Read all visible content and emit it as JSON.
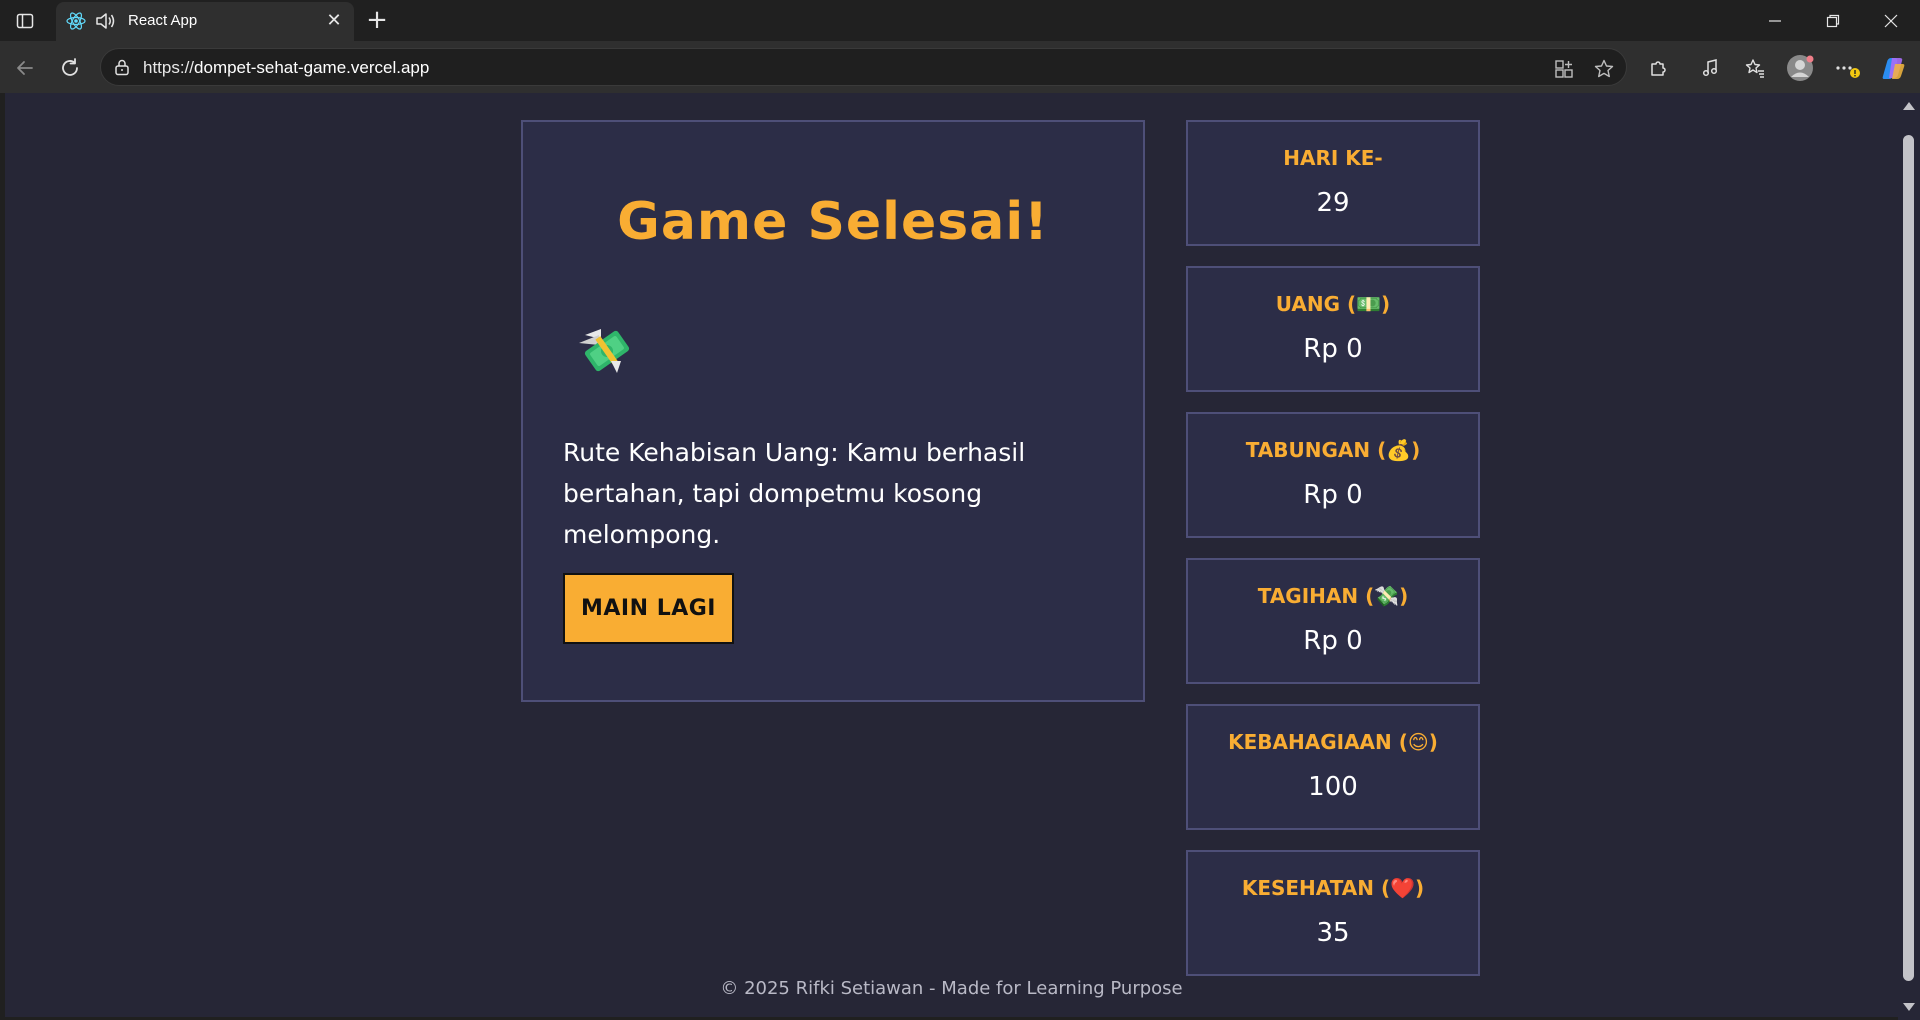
{
  "browser": {
    "tab_title": "React App",
    "url_scheme": "https://",
    "url_host": "dompet-sehat-game.vercel.app"
  },
  "game": {
    "title": "Game Selesai!",
    "emoji": "money-with-wings",
    "route_text": "Rute Kehabisan Uang: Kamu berhasil bertahan, tapi dompetmu kosong melompong.",
    "play_again_label": "MAIN LAGI"
  },
  "stats": [
    {
      "label": "HARI KE-",
      "value": "29"
    },
    {
      "label": "UANG (💵)",
      "value": "Rp 0"
    },
    {
      "label": "TABUNGAN (💰)",
      "value": "Rp 0"
    },
    {
      "label": "TAGIHAN (💸)",
      "value": "Rp 0"
    },
    {
      "label": "KEBAHAGIAAN (😊)",
      "value": "100"
    },
    {
      "label": "KESEHATAN (❤️)",
      "value": "35"
    }
  ],
  "footer": "© 2025 Rifki Setiawan - Made for Learning Purpose",
  "colors": {
    "accent": "#f9ad33",
    "page_bg": "#262636",
    "card_bg": "#2c2d47",
    "card_border": "#4e4f78"
  }
}
